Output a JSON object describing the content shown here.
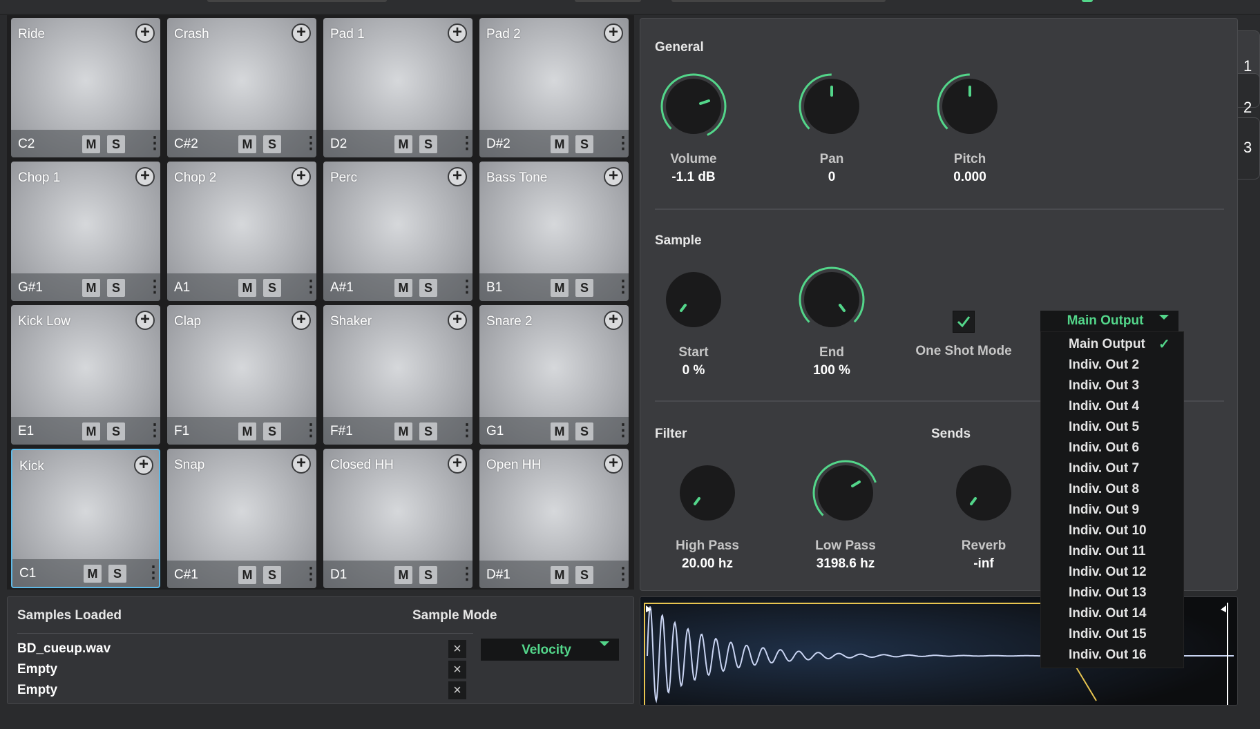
{
  "pads": [
    {
      "name": "Ride",
      "note": "C2"
    },
    {
      "name": "Crash",
      "note": "C#2"
    },
    {
      "name": "Pad 1",
      "note": "D2"
    },
    {
      "name": "Pad 2",
      "note": "D#2"
    },
    {
      "name": "Chop 1",
      "note": "G#1"
    },
    {
      "name": "Chop 2",
      "note": "A1"
    },
    {
      "name": "Perc",
      "note": "A#1"
    },
    {
      "name": "Bass Tone",
      "note": "B1"
    },
    {
      "name": "Kick Low",
      "note": "E1"
    },
    {
      "name": "Clap",
      "note": "F1"
    },
    {
      "name": "Shaker",
      "note": "F#1"
    },
    {
      "name": "Snare 2",
      "note": "G1"
    },
    {
      "name": "Kick",
      "note": "C1"
    },
    {
      "name": "Snap",
      "note": "C#1"
    },
    {
      "name": "Closed HH",
      "note": "D1"
    },
    {
      "name": "Open HH",
      "note": "D#1"
    }
  ],
  "pad_buttons": {
    "plus": "+",
    "mute": "M",
    "solo": "S",
    "menu": "⋮"
  },
  "selected_pad": "Kick",
  "tabs": [
    "1",
    "2",
    "3"
  ],
  "general": {
    "title": "General",
    "volume": {
      "label": "Volume",
      "value": "-1.1 dB"
    },
    "pan": {
      "label": "Pan",
      "value": "0"
    },
    "pitch": {
      "label": "Pitch",
      "value": "0.000"
    }
  },
  "sample": {
    "title": "Sample",
    "start": {
      "label": "Start",
      "value": "0 %"
    },
    "end": {
      "label": "End",
      "value": "100 %"
    },
    "one_shot": {
      "label": "One Shot Mode",
      "checked": true
    }
  },
  "filter": {
    "title": "Filter",
    "high_pass": {
      "label": "High Pass",
      "value": "20.00 hz"
    },
    "low_pass": {
      "label": "Low Pass",
      "value": "3198.6 hz"
    }
  },
  "sends": {
    "title": "Sends",
    "reverb": {
      "label": "Reverb",
      "value": "-inf"
    }
  },
  "output": {
    "selected": "Main Output",
    "options": [
      "Main Output",
      "Indiv. Out 2",
      "Indiv. Out 3",
      "Indiv. Out 4",
      "Indiv. Out 5",
      "Indiv. Out 6",
      "Indiv. Out 7",
      "Indiv. Out 8",
      "Indiv. Out 9",
      "Indiv. Out 10",
      "Indiv. Out 11",
      "Indiv. Out 12",
      "Indiv. Out 13",
      "Indiv. Out 14",
      "Indiv. Out 15",
      "Indiv. Out 16"
    ],
    "check": "✓"
  },
  "samples_loaded": {
    "title": "Samples Loaded",
    "items": [
      "BD_cueup.wav",
      "Empty",
      "Empty"
    ],
    "remove": "×"
  },
  "sample_mode": {
    "title": "Sample Mode",
    "value": "Velocity"
  },
  "colors": {
    "accent": "#53d68a",
    "selection": "#5fb9e6",
    "panel": "#3a3b3e",
    "waveform": "#c9d4f2",
    "marker": "#e8c550"
  }
}
